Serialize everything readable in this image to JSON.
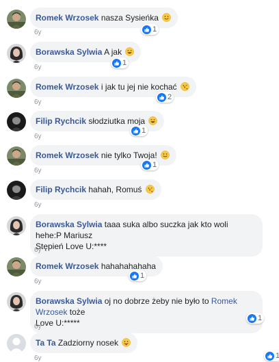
{
  "comments": [
    {
      "author": "Romek Wrzosek",
      "text": "nasza Sysieńka",
      "emoji": "smile",
      "likes": "1",
      "time": "6y"
    },
    {
      "author": "Borawska Sylwia",
      "text": "A jak",
      "emoji": "grin",
      "likes": "1",
      "time": "6y"
    },
    {
      "author": "Romek Wrzosek",
      "text": "i jak tu jej nie kochać",
      "emoji": "kiss",
      "likes": "2",
      "time": "6y"
    },
    {
      "author": "Filip Rychcik",
      "text": "słodziutka moja",
      "emoji": "grin",
      "likes": "1",
      "time": "6y"
    },
    {
      "author": "Romek Wrzosek",
      "text": "nie tylko Twoja!",
      "emoji": "smile",
      "likes": "1",
      "time": "6y"
    },
    {
      "author": "Filip Rychcik",
      "text": "hahah, Romuś",
      "emoji": "kiss",
      "likes": "",
      "time": "6y"
    },
    {
      "author": "Borawska Sylwia",
      "text_line1": "taaa suka albo suczka jak kto woli hehe:P Mariusz",
      "text_line2": "Stępień Love U:****",
      "likes": "",
      "time": "6y"
    },
    {
      "author": "Romek Wrzosek",
      "text": "hahahahahaha",
      "likes": "1",
      "time": "6y"
    },
    {
      "author": "Borawska Sylwia",
      "text_pre": "oj no dobrze żeby nie było to",
      "mention": "Romek Wrzosek",
      "text_post": "toże",
      "text_line2": "Love U:*****",
      "likes": "1",
      "time": "6y"
    },
    {
      "author": "Ta Ta",
      "text": "Zadziorny nosek",
      "emoji": "tongue",
      "likes": "1",
      "time": "6y"
    }
  ],
  "colors": {
    "author": "#385898",
    "bubble": "#f2f3f5",
    "like": "#1877f2"
  }
}
